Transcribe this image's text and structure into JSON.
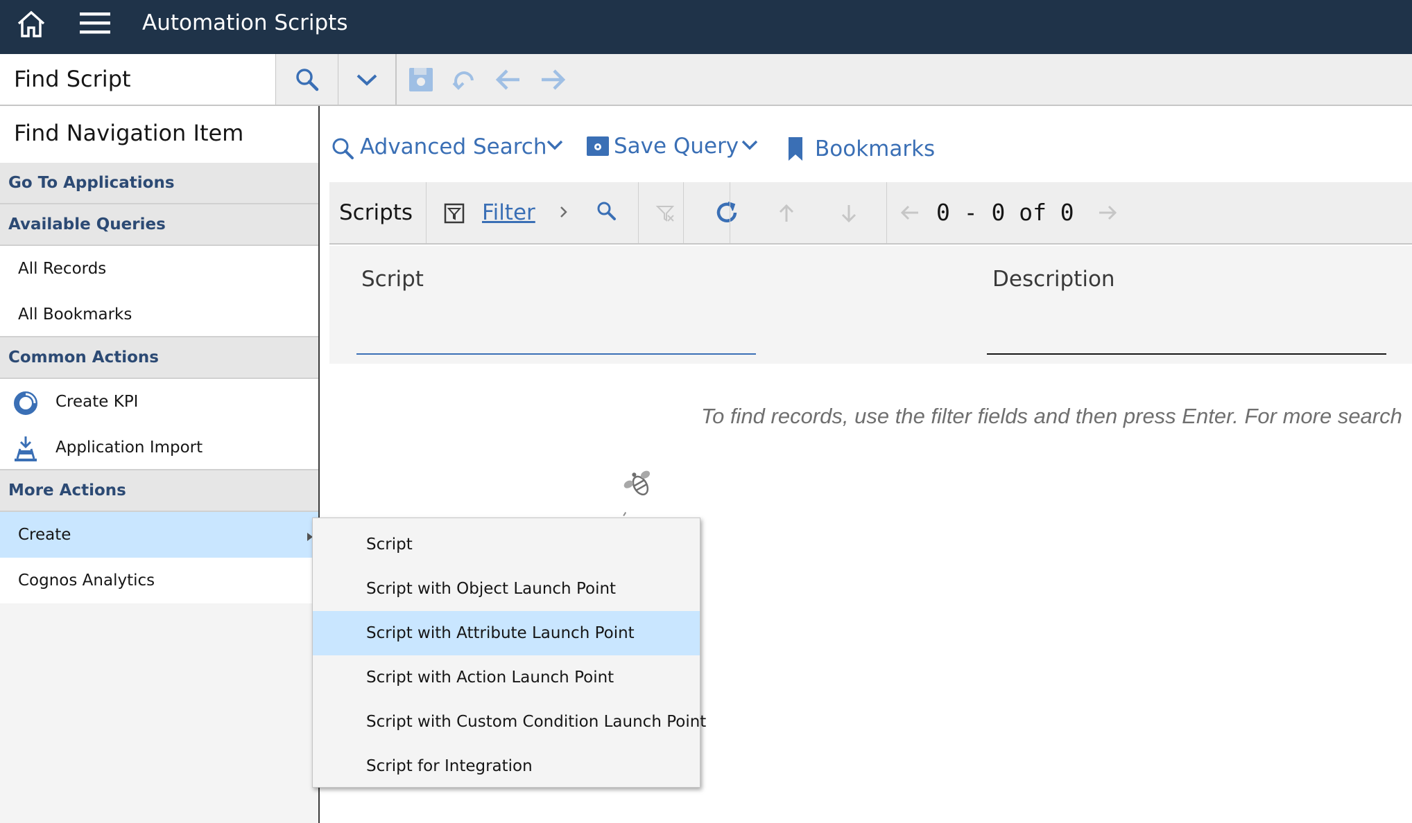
{
  "header": {
    "title": "Automation Scripts",
    "home_icon": "home-icon",
    "menu_icon": "hamburger-menu-icon"
  },
  "secondbar": {
    "find_script_placeholder": "Find Script",
    "icons": [
      "search-icon",
      "chevron-down-icon",
      "save-icon",
      "undo-icon",
      "arrow-left-icon",
      "arrow-right-icon"
    ]
  },
  "sidebar": {
    "find_nav": "Find Navigation Item",
    "go_to_apps": "Go To Applications",
    "available_queries": "Available Queries",
    "queries": [
      "All Records",
      "All Bookmarks"
    ],
    "common_actions": "Common Actions",
    "actions": [
      {
        "label": "Create KPI",
        "icon": "kpi-donut-icon"
      },
      {
        "label": "Application Import",
        "icon": "import-icon"
      }
    ],
    "more_actions": "More Actions",
    "more": [
      {
        "label": "Create",
        "active": true
      },
      {
        "label": "Cognos Analytics",
        "active": false
      }
    ]
  },
  "main": {
    "advanced_search": "Advanced Search",
    "save_query": "Save Query",
    "bookmarks": "Bookmarks",
    "toolbar": {
      "title": "Scripts",
      "filter": "Filter",
      "count": "0 - 0 of 0"
    },
    "columns": {
      "script": "Script",
      "description": "Description"
    },
    "empty_message": "To find records, use the filter fields and then press Enter. For more search"
  },
  "flyout": {
    "items": [
      {
        "label": "Script",
        "active": false
      },
      {
        "label": "Script with Object Launch Point",
        "active": false
      },
      {
        "label": "Script with Attribute Launch Point",
        "active": true
      },
      {
        "label": "Script with Action Launch Point",
        "active": false
      },
      {
        "label": "Script with Custom Condition Launch Point",
        "active": false
      },
      {
        "label": "Script for Integration",
        "active": false
      }
    ]
  },
  "colors": {
    "header_bg": "#1f3349",
    "accent_blue": "#3a6fb5",
    "section_text": "#2c4a74",
    "highlight": "#c9e6ff"
  }
}
